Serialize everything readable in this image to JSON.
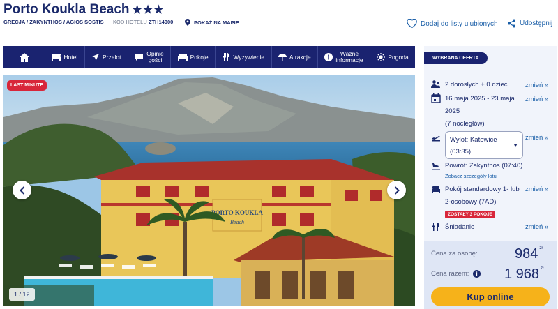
{
  "hotel": {
    "name": "Porto Koukla Beach",
    "stars": "★★★",
    "location": "GRECJA / ZAKYNTHOS / AGIOS SOSTIS",
    "code_label": "KOD HOTELU",
    "code": "ZTH14000",
    "map_link": "POKAŻ NA MAPIE"
  },
  "actions": {
    "favorite": "Dodaj do listy ulubionych",
    "share": "Udostępnij"
  },
  "nav": {
    "hotel": "Hotel",
    "flight": "Przelot",
    "reviews_1": "Opinie",
    "reviews_2": "gości",
    "rooms": "Pokoje",
    "food": "Wyżywienie",
    "attractions": "Atrakcje",
    "info_1": "Ważne",
    "info_2": "informacje",
    "weather": "Pogoda"
  },
  "gallery": {
    "badge": "LAST MINUTE",
    "counter": "1 / 12",
    "sign_1": "PORTO KOUKLA",
    "sign_2": "Beach"
  },
  "offer": {
    "section": "WYBRANA OFERTA",
    "change": "zmień »",
    "guests": "2 dorosłych + 0 dzieci",
    "dates_1": "16 maja 2025 - 23 maja",
    "dates_2": "2025",
    "nights": "(7 nocległów)",
    "departure_1": "Wylot: Katowice",
    "departure_2": "(03:35)",
    "return": "Powrót: Zakynthos (07:40)",
    "flight_details": "Zobacz szczegóły lotu",
    "room_1": "Pokój standardowy 1- lub",
    "room_2": "2-osobowy (7AD)",
    "rooms_left": "ZOSTAŁY 3 POKOJE",
    "board": "Śniadanie"
  },
  "price": {
    "per_person_label": "Cena za osobę:",
    "per_person": "984",
    "total_label": "Cena razem:",
    "total": "1 968",
    "currency": "zł",
    "buy": "Kup online"
  },
  "colors": {
    "navy": "#1a2370",
    "accent": "#f6b21a",
    "alert": "#d8263a",
    "link": "#1b5fa8"
  }
}
